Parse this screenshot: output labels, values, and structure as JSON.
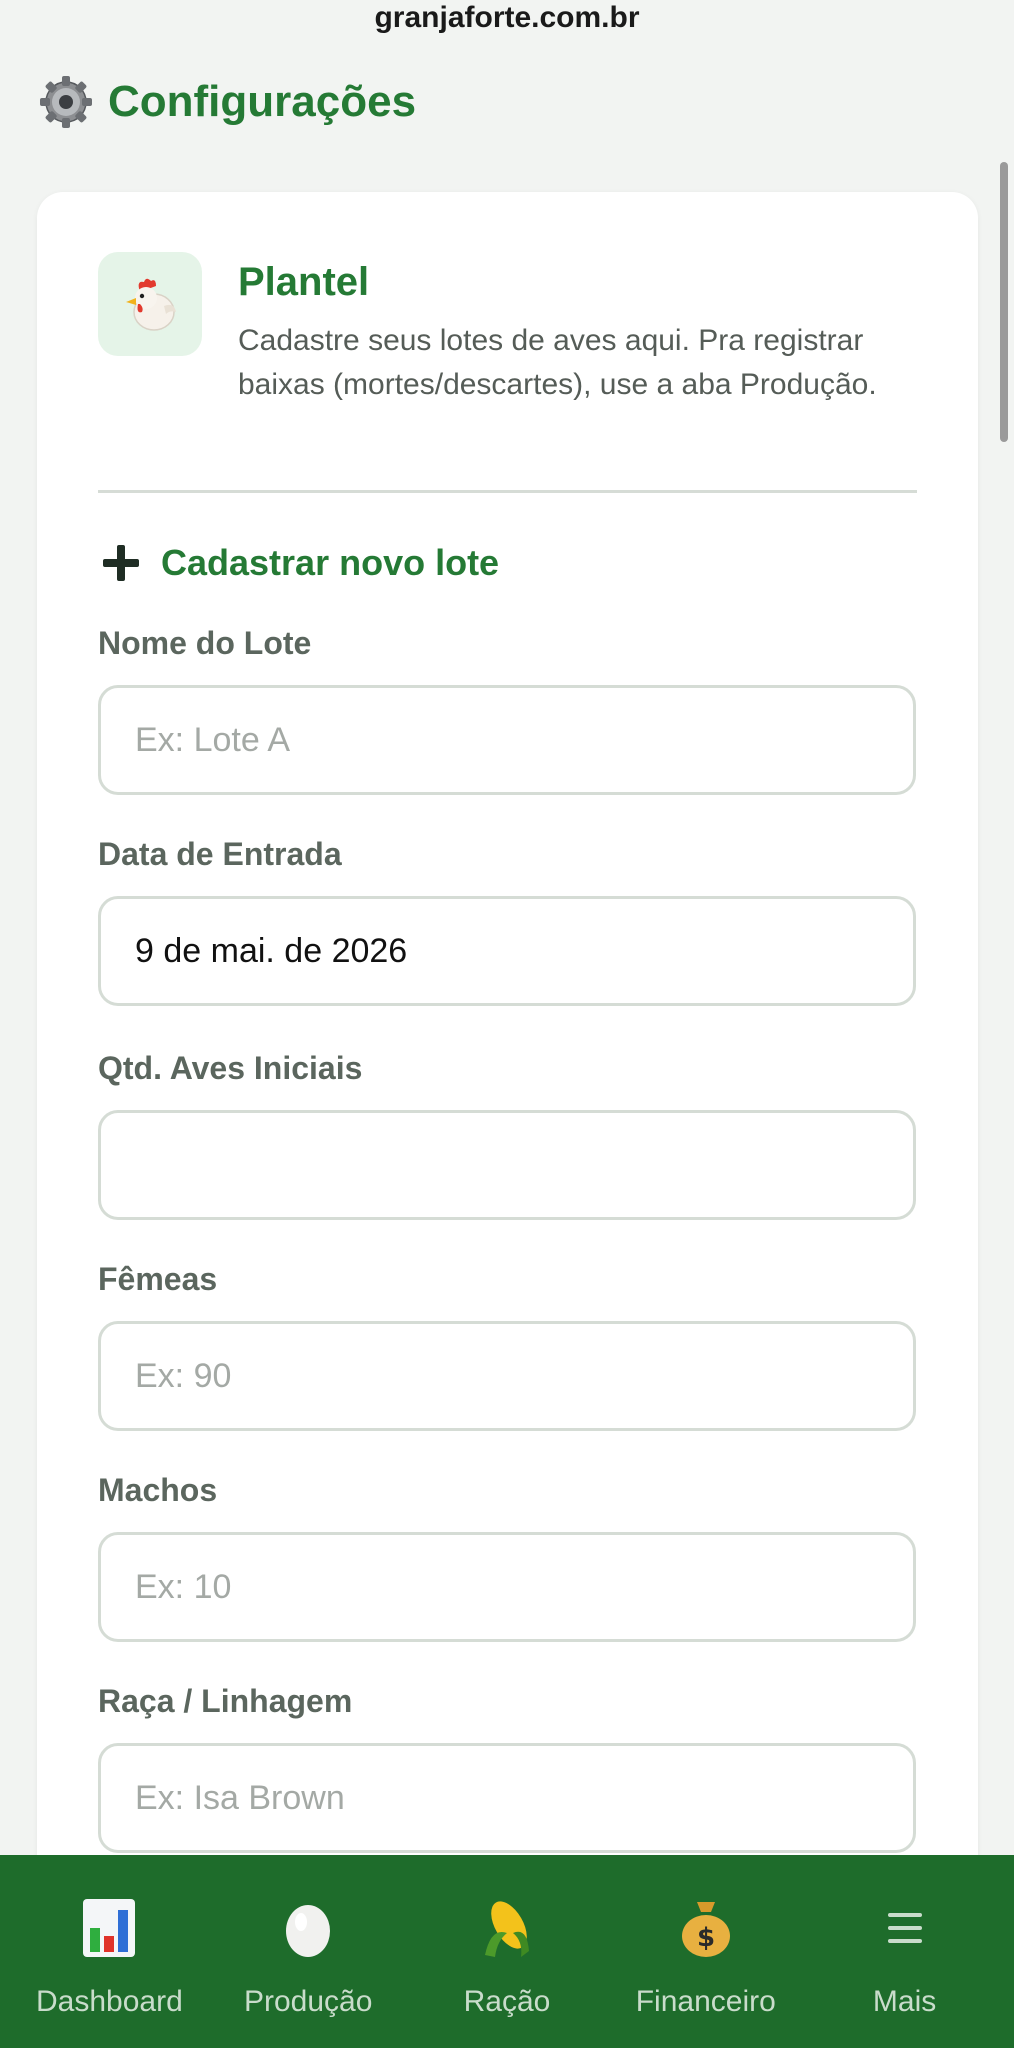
{
  "browser": {
    "url": "granjaforte.com.br"
  },
  "header": {
    "title": "Configurações",
    "icon": "gear-icon"
  },
  "section": {
    "icon": "chicken-icon",
    "title": "Plantel",
    "description": "Cadastre seus lotes de aves aqui. Pra registrar baixas (mortes/descartes), use a aba Produção."
  },
  "form": {
    "heading": "Cadastrar novo lote",
    "fields": {
      "lot_name": {
        "label": "Nome do Lote",
        "value": "",
        "placeholder": "Ex: Lote A"
      },
      "entry_date": {
        "label": "Data de Entrada",
        "value": "9 de mai. de 2026"
      },
      "initial_birds": {
        "label": "Qtd. Aves Iniciais",
        "value": ""
      },
      "females": {
        "label": "Fêmeas",
        "value": "",
        "placeholder": "Ex: 90"
      },
      "males": {
        "label": "Machos",
        "value": "",
        "placeholder": "Ex: 10"
      },
      "breed": {
        "label": "Raça / Linhagem",
        "value": "",
        "placeholder": "Ex: Isa Brown"
      }
    }
  },
  "nav": {
    "items": [
      {
        "label": "Dashboard",
        "icon": "bar-chart-icon"
      },
      {
        "label": "Produção",
        "icon": "egg-icon"
      },
      {
        "label": "Ração",
        "icon": "corn-icon"
      },
      {
        "label": "Financeiro",
        "icon": "money-bag-icon"
      },
      {
        "label": "Mais",
        "icon": "hamburger-menu-icon"
      }
    ]
  },
  "colors": {
    "accent": "#257a35",
    "nav_background": "#1e6c2b",
    "page_background": "#f2f4f2"
  }
}
